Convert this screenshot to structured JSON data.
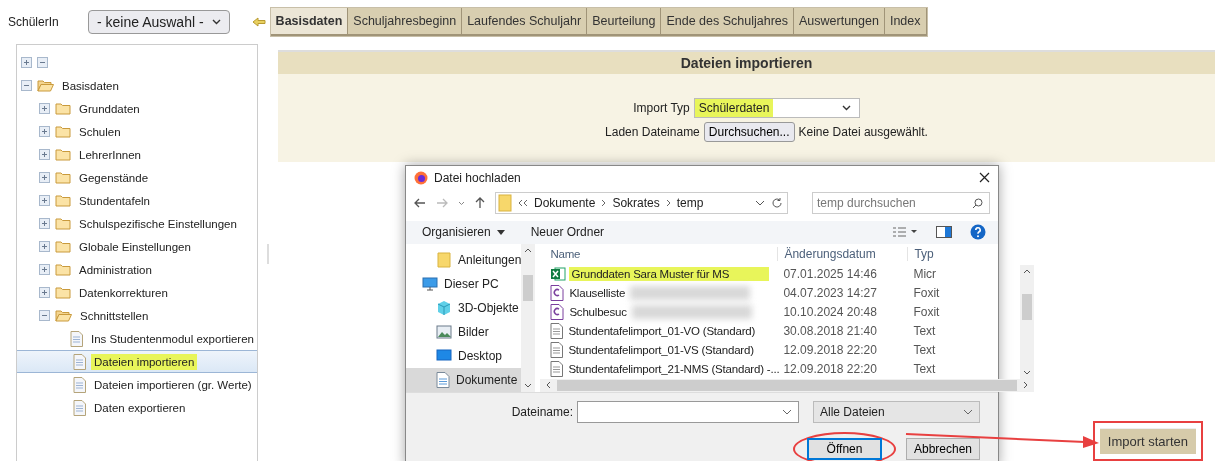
{
  "top_bar": {
    "student_label": "SchülerIn",
    "student_select": "- keine Auswahl -",
    "tabs": [
      {
        "label": "Basisdaten",
        "selected": true
      },
      {
        "label": "Schuljahresbeginn",
        "selected": false
      },
      {
        "label": "Laufendes Schuljahr",
        "selected": false
      },
      {
        "label": "Beurteilung",
        "selected": false
      },
      {
        "label": "Ende des Schuljahres",
        "selected": false
      },
      {
        "label": "Auswertungen",
        "selected": false
      },
      {
        "label": "Index",
        "selected": false
      }
    ]
  },
  "tree": {
    "items": [
      {
        "label": "Basisdaten",
        "kind": "folder",
        "expanded": true,
        "selected": false,
        "highlighted": false,
        "children": [
          {
            "label": "Grunddaten",
            "kind": "folder",
            "expanded": false,
            "selected": false,
            "highlighted": false
          },
          {
            "label": "Schulen",
            "kind": "folder",
            "expanded": false,
            "selected": false,
            "highlighted": false
          },
          {
            "label": "LehrerInnen",
            "kind": "folder",
            "expanded": false,
            "selected": false,
            "highlighted": false
          },
          {
            "label": "Gegenstände",
            "kind": "folder",
            "expanded": false,
            "selected": false,
            "highlighted": false
          },
          {
            "label": "Stundentafeln",
            "kind": "folder",
            "expanded": false,
            "selected": false,
            "highlighted": false
          },
          {
            "label": "Schulspezifische Einstellungen",
            "kind": "folder",
            "expanded": false,
            "selected": false,
            "highlighted": false
          },
          {
            "label": "Globale Einstellungen",
            "kind": "folder",
            "expanded": false,
            "selected": false,
            "highlighted": false
          },
          {
            "label": "Administration",
            "kind": "folder",
            "expanded": false,
            "selected": false,
            "highlighted": false
          },
          {
            "label": "Datenkorrekturen",
            "kind": "folder",
            "expanded": false,
            "selected": false,
            "highlighted": false
          },
          {
            "label": "Schnittstellen",
            "kind": "folder",
            "expanded": true,
            "selected": false,
            "highlighted": false,
            "children": [
              {
                "label": "Ins Studentenmodul exportieren",
                "kind": "page",
                "selected": false,
                "highlighted": false
              },
              {
                "label": "Dateien importieren",
                "kind": "page",
                "selected": true,
                "highlighted": true
              },
              {
                "label": "Dateien importieren (gr. Werte)",
                "kind": "page",
                "selected": false,
                "highlighted": false
              },
              {
                "label": "Daten exportieren",
                "kind": "page",
                "selected": false,
                "highlighted": false
              }
            ]
          }
        ]
      }
    ]
  },
  "panel": {
    "title": "Dateien importieren",
    "import_type_label": "Import Typ",
    "import_type_value": "Schülerdaten",
    "import_type_highlighted": true,
    "file_label": "Laden Dateiname",
    "browse_button": "Durchsuchen...",
    "file_status": "Keine Datei ausgewählt.",
    "submit_button": "Import starten",
    "submit_boxed": true
  },
  "dialog": {
    "title": "Datei hochladen",
    "path": [
      "Dokumente",
      "Sokrates",
      "temp"
    ],
    "search_placeholder": "temp durchsuchen",
    "toolbar": [
      "Organisieren",
      "Neuer Ordner"
    ],
    "nav_items": [
      {
        "label": "Anleitungen",
        "kind": "folder",
        "selected": false
      },
      {
        "label": "Dieser PC",
        "kind": "pc",
        "selected": false
      },
      {
        "label": "3D-Objekte",
        "kind": "cube",
        "selected": false
      },
      {
        "label": "Bilder",
        "kind": "pictures",
        "selected": false
      },
      {
        "label": "Desktop",
        "kind": "desktop",
        "selected": false
      },
      {
        "label": "Dokumente",
        "kind": "documents",
        "selected": true
      }
    ],
    "columns": [
      "Name",
      "Änderungsdatum",
      "Typ"
    ],
    "files": [
      {
        "name": "Grunddaten Sara Muster für MS",
        "date": "07.01.2025 14:46",
        "type": "Micr",
        "kind": "excel",
        "highlighted": true,
        "redacted": false
      },
      {
        "name": "Klauselliste",
        "date": "04.07.2023 14:27",
        "type": "Foxit",
        "kind": "pdf",
        "highlighted": false,
        "redacted": true
      },
      {
        "name": "Schulbesuc",
        "date": "10.10.2024 20:48",
        "type": "Foxit",
        "kind": "pdf",
        "highlighted": false,
        "redacted": true
      },
      {
        "name": "Stundentafelimport_01-VO (Standard)",
        "date": "30.08.2018 21:40",
        "type": "Text",
        "kind": "text",
        "highlighted": false,
        "redacted": false
      },
      {
        "name": "Stundentafelimport_01-VS (Standard)",
        "date": "12.09.2018 22:20",
        "type": "Text",
        "kind": "text",
        "highlighted": false,
        "redacted": false
      },
      {
        "name": "Stundentafelimport_21-NMS (Standard) -...",
        "date": "12.09.2018 22:20",
        "type": "Text",
        "kind": "text",
        "highlighted": false,
        "redacted": false
      }
    ],
    "filename_label": "Dateiname:",
    "filter": "Alle Dateien",
    "open_button": "Öffnen",
    "open_circled": true,
    "cancel_button": "Abbrechen"
  }
}
